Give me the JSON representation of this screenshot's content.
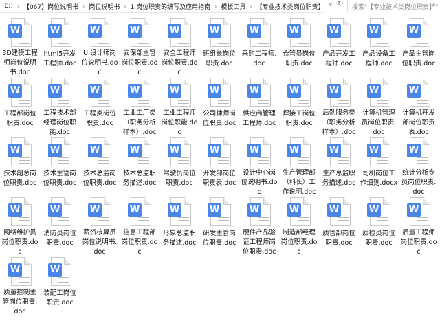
{
  "address_bar": {
    "crumbs": [
      "(E:)",
      "【067】岗位说明书",
      "岗位说明书",
      "1.岗位职责的编写及应用指南",
      "模板工具",
      "【专业技术类岗位职责】"
    ],
    "separator": "›",
    "dropdown_icon": "∨",
    "refresh_icon": "↻"
  },
  "search": {
    "placeholder": "搜索\"【专业技术类岗位职责】\"",
    "icon": "⌕"
  },
  "icon_letter": "W",
  "files": [
    "3D建模工程师岗位说明书.doc",
    "html5开发工程师.doc",
    "UI设计师岗位说明书.doc",
    "安保部主管岗位职责.doc",
    "安全工程师岗位职责.doc",
    "班组长岗位职责.doc",
    "采购工程师.doc",
    "仓管员岗位职责.doc",
    "产品开发工程师.doc",
    "产品设备工程师.doc",
    "产品主管岗位职责.doc",
    "工程部岗位职责.doc",
    "工程技术部经理岗位职能.doc",
    "工程类岗位职责.doc",
    "工业工厂类（职务分析样本）.doc",
    "工业工程师岗位职能.doc",
    "公司律师岗位职责.doc",
    "供应商管理工程师.doc",
    "焊接工岗位职责.doc",
    "后勤服务类（职务分析样本）.doc",
    "计算机管理员岗位职责.doc",
    "计算机开发部岗位职责表.doc",
    "技术副总岗位职责.doc",
    "技术主管岗位职责.doc",
    "技术总监岗位职责.doc",
    "技术总监职务描述.doc",
    "驾驶员岗位职责.doc",
    "开发部岗位职责表.doc",
    "设计中心岗位说明书.doc",
    "生产管理部（科长）工作说明.doc",
    "生产总监职务描述.doc",
    "司机岗位工作细则.docx",
    "统计分析专员岗位职责.doc",
    "网络维护员岗位职责.doc",
    "消防员岗位职责.doc",
    "薪资核算员岗位说明书.doc",
    "信息工程部岗位职责.doc",
    "形象总监职务描述.doc",
    "研发主管岗位职责.doc",
    "硬件产品验证工程师岗位职责.doc",
    "制造部经理岗位职责.doc",
    "质管部岗位职责.doc",
    "质检员岗位职责.doc",
    "质量工程师岗位职责.doc",
    "质量控制主管岗位职责.doc",
    "装配工岗位职责.doc"
  ]
}
